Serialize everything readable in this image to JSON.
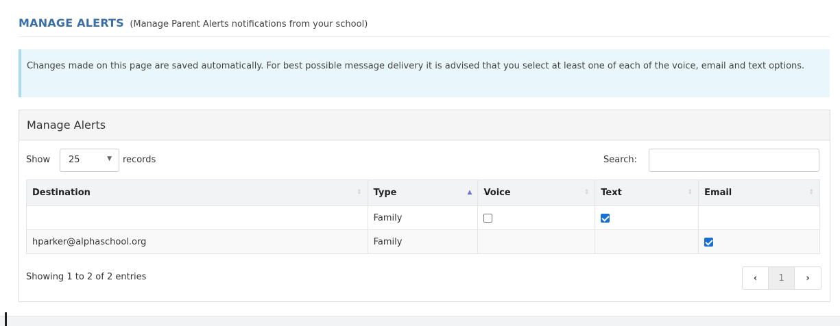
{
  "header": {
    "title": "MANAGE ALERTS",
    "subtitle": "(Manage Parent Alerts notifications from your school)"
  },
  "info": {
    "text": "Changes made on this page are saved automatically. For best possible message delivery it is advised that you select at least one of each of the voice, email and text options."
  },
  "panel": {
    "title": "Manage Alerts",
    "show_label": "Show",
    "records_value": "25",
    "records_label": "records",
    "search_label": "Search:",
    "search_value": ""
  },
  "table": {
    "columns": [
      "Destination",
      "Type",
      "Voice",
      "Text",
      "Email"
    ],
    "sorted_column": "Type",
    "rows": [
      {
        "destination": "",
        "type": "Family",
        "voice": "unchecked",
        "text": "checked",
        "email": ""
      },
      {
        "destination": "hparker@alphaschool.org",
        "type": "Family",
        "voice": "",
        "text": "",
        "email": "checked"
      }
    ]
  },
  "footer": {
    "info": "Showing 1 to 2 of 2 entries",
    "prev": "‹",
    "page": "1",
    "next": "›"
  },
  "icons": {
    "sort_default": "sort-both-icon",
    "sort_active": "sort-asc-icon",
    "dropdown": "chevron-down-icon"
  },
  "colors": {
    "title": "#3a6ea5",
    "info_bg": "#e9f6fb",
    "info_border": "#a7dcef",
    "checkbox": "#1a6fd6"
  }
}
